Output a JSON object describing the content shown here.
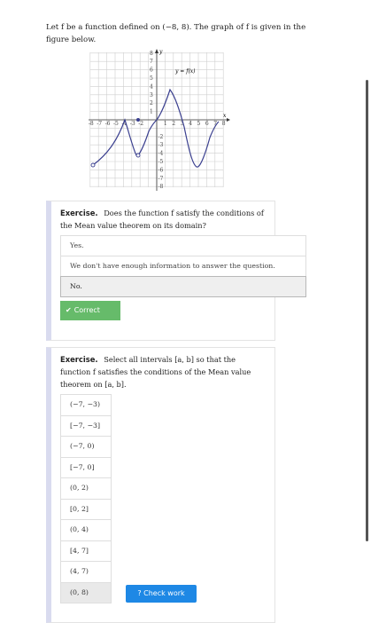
{
  "intro_text": "Let f be a function defined on (−8, 8). The graph of f is given in the figure below.",
  "graph": {
    "y_axis_label": "y",
    "x_axis_label": "x",
    "curve_label": "y = f(x)",
    "x_ticks_neg": [
      "-8",
      "-7",
      "-6",
      "-5",
      "-4",
      "-3",
      "-2"
    ],
    "x_ticks_pos": [
      "1",
      "2",
      "3",
      "4",
      "5",
      "6",
      "7",
      "8"
    ],
    "y_ticks_pos": [
      "1",
      "2",
      "3",
      "4",
      "5",
      "6",
      "7",
      "8"
    ],
    "y_ticks_neg": [
      "-2",
      "-3",
      "-4",
      "-5",
      "-6",
      "-7",
      "-8"
    ],
    "curve_color": "#3a3f8f"
  },
  "exercise1": {
    "title": "Exercise.",
    "question": "Does the function f satisfy the conditions of the Mean value theorem on its domain?",
    "options": [
      "Yes.",
      "We don't have enough information to answer the question.",
      "No."
    ],
    "selected_index": 2,
    "feedback": "Correct"
  },
  "exercise2": {
    "title": "Exercise.",
    "question": "Select all intervals [a, b] so that the function f satisfies the conditions of the Mean value theorem on [a, b].",
    "options": [
      "(−7, −3)",
      "[−7, −3]",
      "(−7, 0)",
      "[−7, 0]",
      "(0, 2)",
      "[0, 2]",
      "(0, 4)",
      "[4, 7]",
      "(4, 7)",
      "(0, 8)"
    ],
    "selected_index": 9,
    "check_label": "? Check work"
  },
  "colors": {
    "correct_green": "#66bb6a",
    "check_blue": "#1e88e5",
    "accent_bar": "#d9dbef"
  }
}
